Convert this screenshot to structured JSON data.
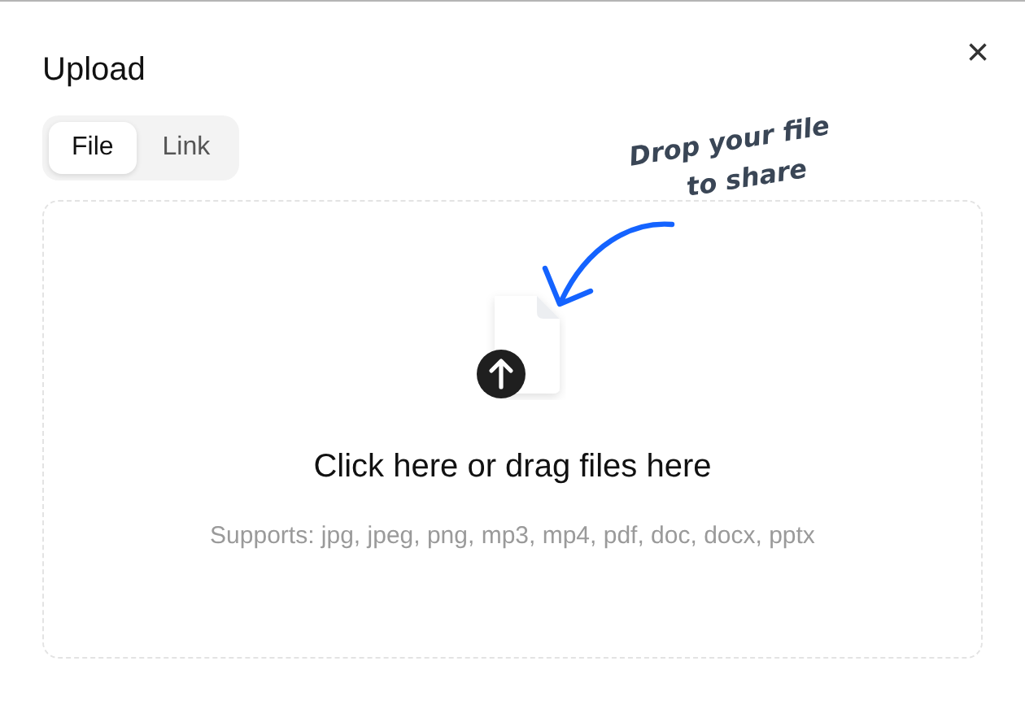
{
  "dialog": {
    "title": "Upload",
    "close": "×"
  },
  "tabs": [
    {
      "label": "File",
      "selected": true
    },
    {
      "label": "Link",
      "selected": false
    }
  ],
  "dropzone": {
    "note": [
      "Drop your file",
      "to share"
    ],
    "heading": "Click here or drag files here",
    "supports": "Supports: jpg, jpeg, png, mp3, mp4, pdf, doc, docx, pptx"
  }
}
